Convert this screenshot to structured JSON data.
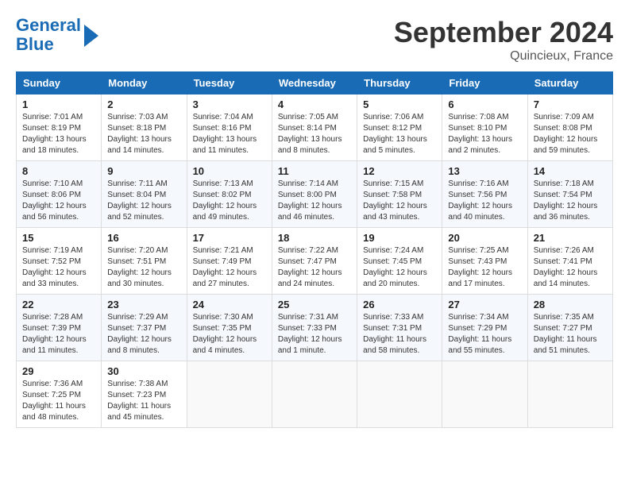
{
  "logo": {
    "line1": "General",
    "line2": "Blue"
  },
  "title": "September 2024",
  "subtitle": "Quincieux, France",
  "headers": [
    "Sunday",
    "Monday",
    "Tuesday",
    "Wednesday",
    "Thursday",
    "Friday",
    "Saturday"
  ],
  "weeks": [
    [
      {
        "day": "1",
        "info": "Sunrise: 7:01 AM\nSunset: 8:19 PM\nDaylight: 13 hours\nand 18 minutes."
      },
      {
        "day": "2",
        "info": "Sunrise: 7:03 AM\nSunset: 8:18 PM\nDaylight: 13 hours\nand 14 minutes."
      },
      {
        "day": "3",
        "info": "Sunrise: 7:04 AM\nSunset: 8:16 PM\nDaylight: 13 hours\nand 11 minutes."
      },
      {
        "day": "4",
        "info": "Sunrise: 7:05 AM\nSunset: 8:14 PM\nDaylight: 13 hours\nand 8 minutes."
      },
      {
        "day": "5",
        "info": "Sunrise: 7:06 AM\nSunset: 8:12 PM\nDaylight: 13 hours\nand 5 minutes."
      },
      {
        "day": "6",
        "info": "Sunrise: 7:08 AM\nSunset: 8:10 PM\nDaylight: 13 hours\nand 2 minutes."
      },
      {
        "day": "7",
        "info": "Sunrise: 7:09 AM\nSunset: 8:08 PM\nDaylight: 12 hours\nand 59 minutes."
      }
    ],
    [
      {
        "day": "8",
        "info": "Sunrise: 7:10 AM\nSunset: 8:06 PM\nDaylight: 12 hours\nand 56 minutes."
      },
      {
        "day": "9",
        "info": "Sunrise: 7:11 AM\nSunset: 8:04 PM\nDaylight: 12 hours\nand 52 minutes."
      },
      {
        "day": "10",
        "info": "Sunrise: 7:13 AM\nSunset: 8:02 PM\nDaylight: 12 hours\nand 49 minutes."
      },
      {
        "day": "11",
        "info": "Sunrise: 7:14 AM\nSunset: 8:00 PM\nDaylight: 12 hours\nand 46 minutes."
      },
      {
        "day": "12",
        "info": "Sunrise: 7:15 AM\nSunset: 7:58 PM\nDaylight: 12 hours\nand 43 minutes."
      },
      {
        "day": "13",
        "info": "Sunrise: 7:16 AM\nSunset: 7:56 PM\nDaylight: 12 hours\nand 40 minutes."
      },
      {
        "day": "14",
        "info": "Sunrise: 7:18 AM\nSunset: 7:54 PM\nDaylight: 12 hours\nand 36 minutes."
      }
    ],
    [
      {
        "day": "15",
        "info": "Sunrise: 7:19 AM\nSunset: 7:52 PM\nDaylight: 12 hours\nand 33 minutes."
      },
      {
        "day": "16",
        "info": "Sunrise: 7:20 AM\nSunset: 7:51 PM\nDaylight: 12 hours\nand 30 minutes."
      },
      {
        "day": "17",
        "info": "Sunrise: 7:21 AM\nSunset: 7:49 PM\nDaylight: 12 hours\nand 27 minutes."
      },
      {
        "day": "18",
        "info": "Sunrise: 7:22 AM\nSunset: 7:47 PM\nDaylight: 12 hours\nand 24 minutes."
      },
      {
        "day": "19",
        "info": "Sunrise: 7:24 AM\nSunset: 7:45 PM\nDaylight: 12 hours\nand 20 minutes."
      },
      {
        "day": "20",
        "info": "Sunrise: 7:25 AM\nSunset: 7:43 PM\nDaylight: 12 hours\nand 17 minutes."
      },
      {
        "day": "21",
        "info": "Sunrise: 7:26 AM\nSunset: 7:41 PM\nDaylight: 12 hours\nand 14 minutes."
      }
    ],
    [
      {
        "day": "22",
        "info": "Sunrise: 7:28 AM\nSunset: 7:39 PM\nDaylight: 12 hours\nand 11 minutes."
      },
      {
        "day": "23",
        "info": "Sunrise: 7:29 AM\nSunset: 7:37 PM\nDaylight: 12 hours\nand 8 minutes."
      },
      {
        "day": "24",
        "info": "Sunrise: 7:30 AM\nSunset: 7:35 PM\nDaylight: 12 hours\nand 4 minutes."
      },
      {
        "day": "25",
        "info": "Sunrise: 7:31 AM\nSunset: 7:33 PM\nDaylight: 12 hours\nand 1 minute."
      },
      {
        "day": "26",
        "info": "Sunrise: 7:33 AM\nSunset: 7:31 PM\nDaylight: 11 hours\nand 58 minutes."
      },
      {
        "day": "27",
        "info": "Sunrise: 7:34 AM\nSunset: 7:29 PM\nDaylight: 11 hours\nand 55 minutes."
      },
      {
        "day": "28",
        "info": "Sunrise: 7:35 AM\nSunset: 7:27 PM\nDaylight: 11 hours\nand 51 minutes."
      }
    ],
    [
      {
        "day": "29",
        "info": "Sunrise: 7:36 AM\nSunset: 7:25 PM\nDaylight: 11 hours\nand 48 minutes."
      },
      {
        "day": "30",
        "info": "Sunrise: 7:38 AM\nSunset: 7:23 PM\nDaylight: 11 hours\nand 45 minutes."
      },
      {
        "day": "",
        "info": ""
      },
      {
        "day": "",
        "info": ""
      },
      {
        "day": "",
        "info": ""
      },
      {
        "day": "",
        "info": ""
      },
      {
        "day": "",
        "info": ""
      }
    ]
  ]
}
